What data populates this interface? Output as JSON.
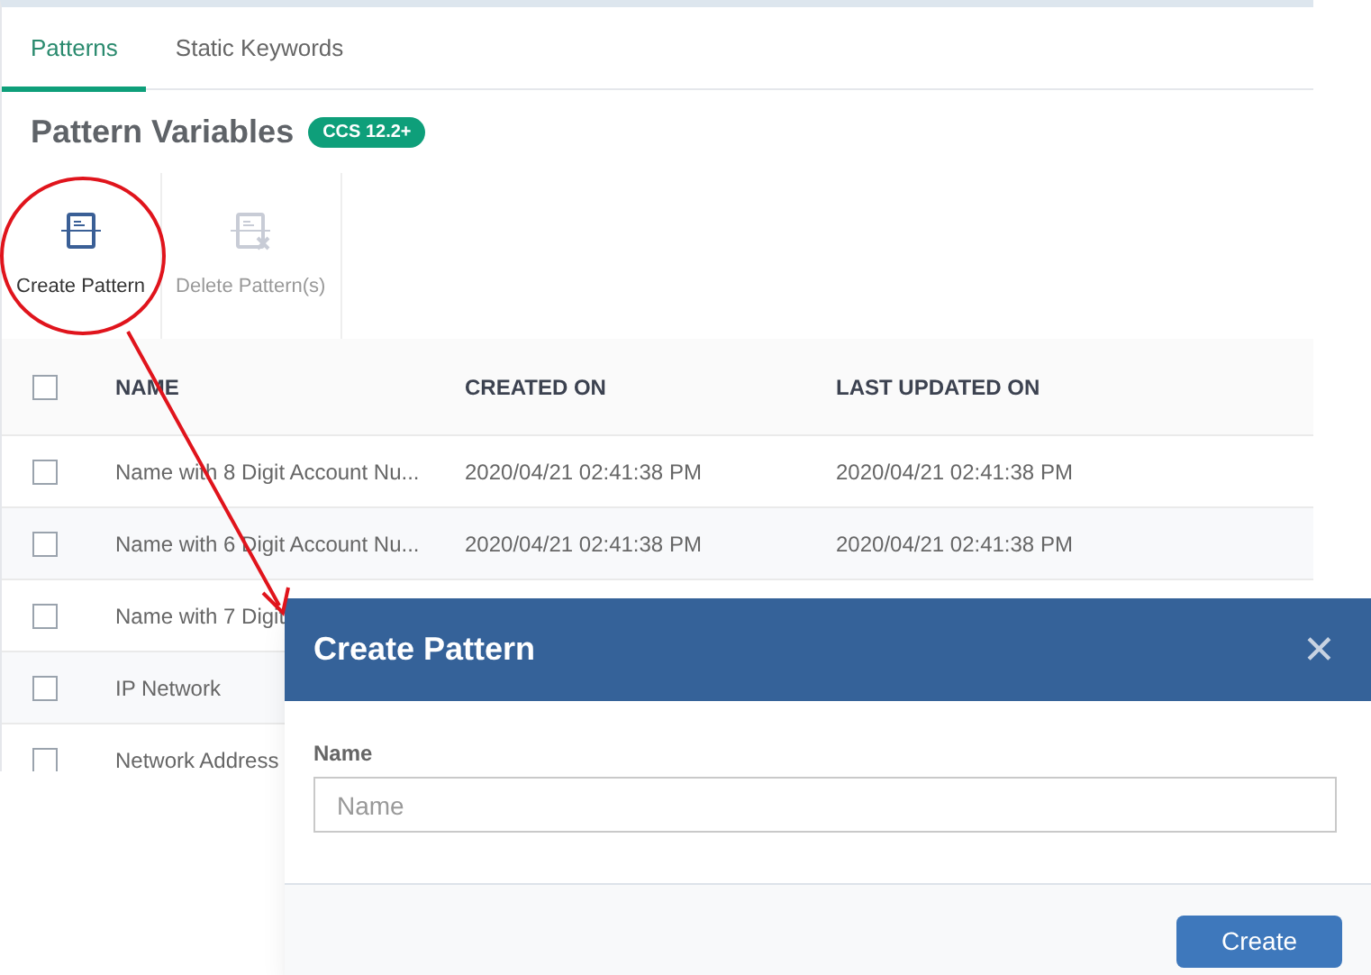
{
  "tabs": [
    {
      "label": "Patterns",
      "selected": true
    },
    {
      "label": "Static Keywords",
      "selected": false
    }
  ],
  "heading": {
    "title": "Pattern Variables",
    "badge": "CCS 12.2+"
  },
  "toolbar": [
    {
      "label": "Create Pattern",
      "disabled": false,
      "kind": "create"
    },
    {
      "label": "Delete Pattern(s)",
      "disabled": true,
      "kind": "delete"
    }
  ],
  "table": {
    "select_all": {
      "checked": false
    },
    "columns": [
      "NAME",
      "CREATED ON",
      "LAST UPDATED ON"
    ],
    "rows": [
      {
        "checked": false,
        "cells": [
          "Name with 8 Digit Account Nu...",
          "2020/04/21 02:41:38 PM",
          "2020/04/21 02:41:38 PM"
        ]
      },
      {
        "checked": false,
        "cells": [
          "Name with 6 Digit Account Nu...",
          "2020/04/21 02:41:38 PM",
          "2020/04/21 02:41:38 PM"
        ]
      },
      {
        "checked": false,
        "cells": [
          "Name with 7 Digit"
        ]
      },
      {
        "checked": false,
        "cells": [
          "IP Network"
        ]
      },
      {
        "checked": false,
        "cells": [
          "Network Address"
        ]
      }
    ]
  },
  "dialog": {
    "title": "Create Pattern",
    "close": "✕",
    "field_label": "Name",
    "placeholder": "Name",
    "button": "Create"
  }
}
